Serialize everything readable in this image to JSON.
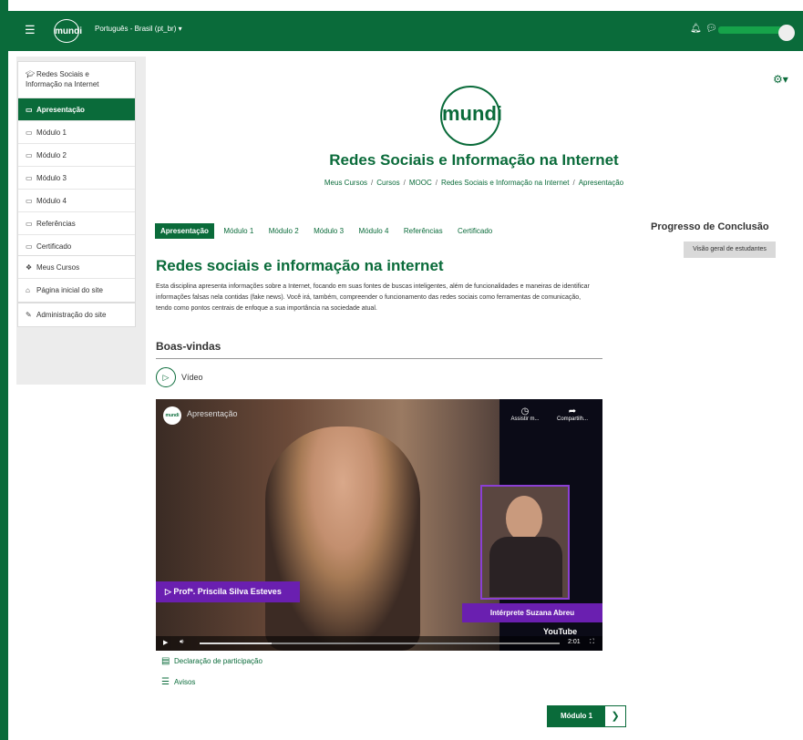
{
  "topbar": {
    "logo_text": "mundi",
    "language": "Português - Brasil (pt_br) ▾"
  },
  "sidebar": {
    "course_nav": [
      {
        "label": "Redes Sociais e Informação na Internet",
        "icon": "graduation-cap-icon"
      },
      {
        "label": "Apresentação",
        "icon": "folder-icon",
        "active": true
      },
      {
        "label": "Módulo 1",
        "icon": "folder-icon"
      },
      {
        "label": "Módulo 2",
        "icon": "folder-icon"
      },
      {
        "label": "Módulo 3",
        "icon": "folder-icon"
      },
      {
        "label": "Módulo 4",
        "icon": "folder-icon"
      },
      {
        "label": "Referências",
        "icon": "folder-icon"
      },
      {
        "label": "Certificado",
        "icon": "folder-icon"
      }
    ],
    "site_nav": [
      {
        "label": "Meus Cursos",
        "icon": "courses-icon"
      },
      {
        "label": "Página inicial do site",
        "icon": "home-icon"
      }
    ],
    "admin_nav": [
      {
        "label": "Administração do site",
        "icon": "wrench-icon"
      }
    ]
  },
  "header": {
    "brand_text": "mundi",
    "course_title": "Redes Sociais e Informação na Internet",
    "breadcrumb": [
      "Meus Cursos",
      "Cursos",
      "MOOC",
      "Redes Sociais e Informação na Internet",
      "Apresentação"
    ]
  },
  "tabs": [
    {
      "label": "Apresentação",
      "active": true
    },
    {
      "label": "Módulo 1"
    },
    {
      "label": "Módulo 2"
    },
    {
      "label": "Módulo 3"
    },
    {
      "label": "Módulo 4"
    },
    {
      "label": "Referências"
    },
    {
      "label": "Certificado"
    }
  ],
  "main": {
    "title": "Redes sociais e informação na internet",
    "intro": "Esta disciplina apresenta informações sobre a Internet, focando em suas fontes de buscas inteligentes, além de funcionalidades e maneiras de identificar informações falsas nela contidas (fake news). Você irá, também, compreender o funcionamento das redes sociais como ferramentas de comunicação, tendo como pontos centrais de enfoque a sua importância na sociedade atual.",
    "welcome_heading": "Boas-vindas",
    "video_label": "Vídeo",
    "video": {
      "title": "Apresentação",
      "logo_text": "mundi",
      "watch_later": "Assistir m...",
      "share": "Compartilh...",
      "presenter": "▷ Profª. Priscila Silva Esteves",
      "interpreter": "Intérprete Suzana Abreu",
      "time": "2:01",
      "youtube": "YouTube",
      "progress": 0.2
    },
    "links": [
      {
        "label": "Declaração de participação",
        "icon": "certificate-icon"
      },
      {
        "label": "Avisos",
        "icon": "forum-icon"
      }
    ],
    "next_button": "Módulo 1"
  },
  "progress": {
    "title": "Progresso de Conclusão",
    "overview_button": "Visão geral de estudantes"
  },
  "colors": {
    "primary": "#0a6b3a",
    "accent_purple": "#6a1fb0"
  }
}
